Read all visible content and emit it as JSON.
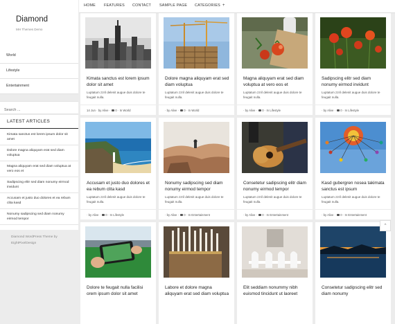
{
  "site": {
    "title": "Diamond",
    "description": "MH Themes Demo",
    "menu": [
      {
        "label": "World"
      },
      {
        "label": "Lifestyle"
      },
      {
        "label": "Entertainment"
      }
    ],
    "search_placeholder": "Search ...",
    "latest_heading": "LATEST ARTICLES",
    "latest": [
      {
        "title": "Kimata sanctus est lorem ipsum dolor sit amet"
      },
      {
        "title": "Dolore magna aliquyam erat sed diam voluptua"
      },
      {
        "title": "Magna aliquyam erat sed diam voluptua at vero eos et"
      },
      {
        "title": "Sadipscing elitr sed diam nonumy eirmod invidunt"
      },
      {
        "title": "Accusam et justo duo dolores et ea rebum clita kasd"
      },
      {
        "title": "Nonumy sadipscing sed diam nonumy eirmod tempor"
      }
    ],
    "credit": "Diamond WordPress Theme by EightPixelDesign"
  },
  "nav": {
    "items": [
      {
        "label": "HOME"
      },
      {
        "label": "FEATURES"
      },
      {
        "label": "CONTACT"
      },
      {
        "label": "SAMPLE PAGE"
      },
      {
        "label": "CATEGORIES"
      }
    ],
    "categories_icon": "+"
  },
  "scroll_top_icon": "^",
  "posts": [
    {
      "title": "Kimata sanctus est lorem ipsum dolor sit amet",
      "excerpt": "Luptatum zzril delenit augue duis dolore te feugait nulla.",
      "meta": "14 Jun · by Alive · ",
      "comments": "0",
      "category": " · In World",
      "image": "city-skyline"
    },
    {
      "title": "Dolore magna aliquyam erat sed diam voluptua",
      "excerpt": "Luptatum zzril delenit augue duis dolore te feugait nulla.",
      "meta": "· by Alive · ",
      "comments": "0",
      "category": " · In World",
      "image": "construction-cranes"
    },
    {
      "title": "Magna aliquyam erat sed diam voluptua at vero eos et",
      "excerpt": "Luptatum zzril delenit augue duis dolore te feugait nulla.",
      "meta": "· by Alive · ",
      "comments": "0",
      "category": " · In Lifestyle",
      "image": "tomatoes-board"
    },
    {
      "title": "Sadipscing elitr sed diam nonumy eirmod invidunt",
      "excerpt": "Luptatum zzril delenit augue duis dolore te feugait nulla.",
      "meta": "· by Alive · ",
      "comments": "0",
      "category": " · In Lifestyle",
      "image": "red-poppies"
    },
    {
      "title": "Accusam et justo duo dolores et ea rebum clita kasd",
      "excerpt": "Luptatum zzril delenit augue duis dolore te feugait nulla.",
      "meta": "· by Alive · ",
      "comments": "0",
      "category": " · In Lifestyle",
      "image": "coastal-waterfall"
    },
    {
      "title": "Nonumy sadipscing sed diam nonumy eirmod tempor",
      "excerpt": "Luptatum zzril delenit augue duis dolore te feugait nulla.",
      "meta": "· by Alive · ",
      "comments": "0",
      "category": " · In Entertainment",
      "image": "desert-hiker"
    },
    {
      "title": "Consetetur sadipscing elitr diam nonumy eirmod tempor",
      "excerpt": "Luptatum zzril delenit augue duis dolore te feugait nulla.",
      "meta": "· by Alive · ",
      "comments": "0",
      "category": " · In Entertainment",
      "image": "acoustic-guitar"
    },
    {
      "title": "Kasd gubergren nosea takimata sanctus est ipsum",
      "excerpt": "Luptatum zzril delenit augue duis dolore te feugait nulla.",
      "meta": "· by Alive · ",
      "comments": "0",
      "category": " · In Entertainment",
      "image": "carnival-swing-ride"
    },
    {
      "title": "Dolore te feugait nulla facilisi orem ipsum dolor sit amet",
      "excerpt": "",
      "meta": "",
      "comments": "",
      "category": "",
      "image": "stadium-phone"
    },
    {
      "title": "Labore et dolore magna aliquyam erat sed diam voluptua",
      "excerpt": "",
      "meta": "",
      "comments": "",
      "category": "",
      "image": "paintbrushes"
    },
    {
      "title": "Elit seddiam nonummy nibh euismod tincidunt ut laoreet",
      "excerpt": "",
      "meta": "",
      "comments": "",
      "category": "",
      "image": "dining-chairs"
    },
    {
      "title": "Consetetur sadipscing elitr sed diam nonumy",
      "excerpt": "",
      "meta": "",
      "comments": "",
      "category": "",
      "image": "night-lake"
    }
  ]
}
